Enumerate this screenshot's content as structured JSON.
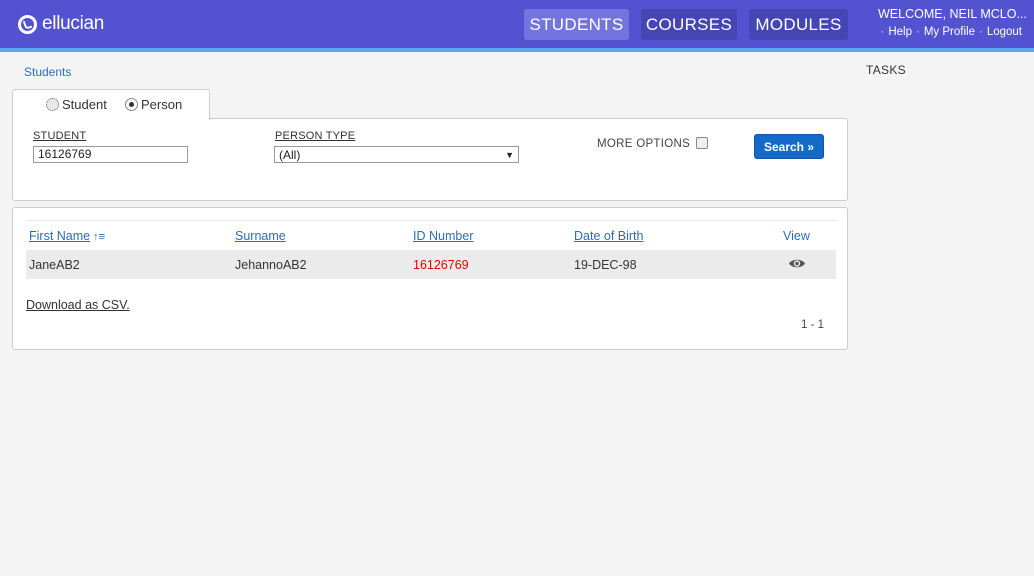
{
  "header": {
    "logo_text": "ellucian",
    "nav": [
      {
        "label": "STUDENTS",
        "active": true
      },
      {
        "label": "COURSES",
        "active": false
      },
      {
        "label": "MODULES",
        "active": false
      }
    ],
    "welcome": "WELCOME, NEIL MCLO...",
    "links": {
      "help": "Help",
      "profile": "My Profile",
      "logout": "Logout",
      "separator": "·"
    }
  },
  "breadcrumb": "Students",
  "tasks_title": "TASKS",
  "search": {
    "mode_options": [
      {
        "label": "Student",
        "selected": false
      },
      {
        "label": "Person",
        "selected": true
      }
    ],
    "student_label": "STUDENT",
    "student_value": "16126769",
    "person_type_label": "PERSON TYPE",
    "person_type_value": "(All)",
    "more_options_label": "MORE OPTIONS",
    "more_options_checked": false,
    "search_button": "Search »"
  },
  "results": {
    "columns": [
      "First Name",
      "Surname",
      "ID Number",
      "Date of Birth",
      "View"
    ],
    "rows": [
      {
        "first_name": "JaneAB2",
        "surname": "JehannoAB2",
        "id_number": "16126769",
        "dob": "19-DEC-98",
        "view_icon": "eye-icon"
      }
    ],
    "download_label": "Download as CSV.",
    "pager": "1 - 1"
  },
  "colors": {
    "header_bg": "#5353d1",
    "accent_stripe": "#5aa8f0",
    "link": "#2e6db4",
    "id_highlight": "#e00000",
    "button": "#1569c7"
  }
}
